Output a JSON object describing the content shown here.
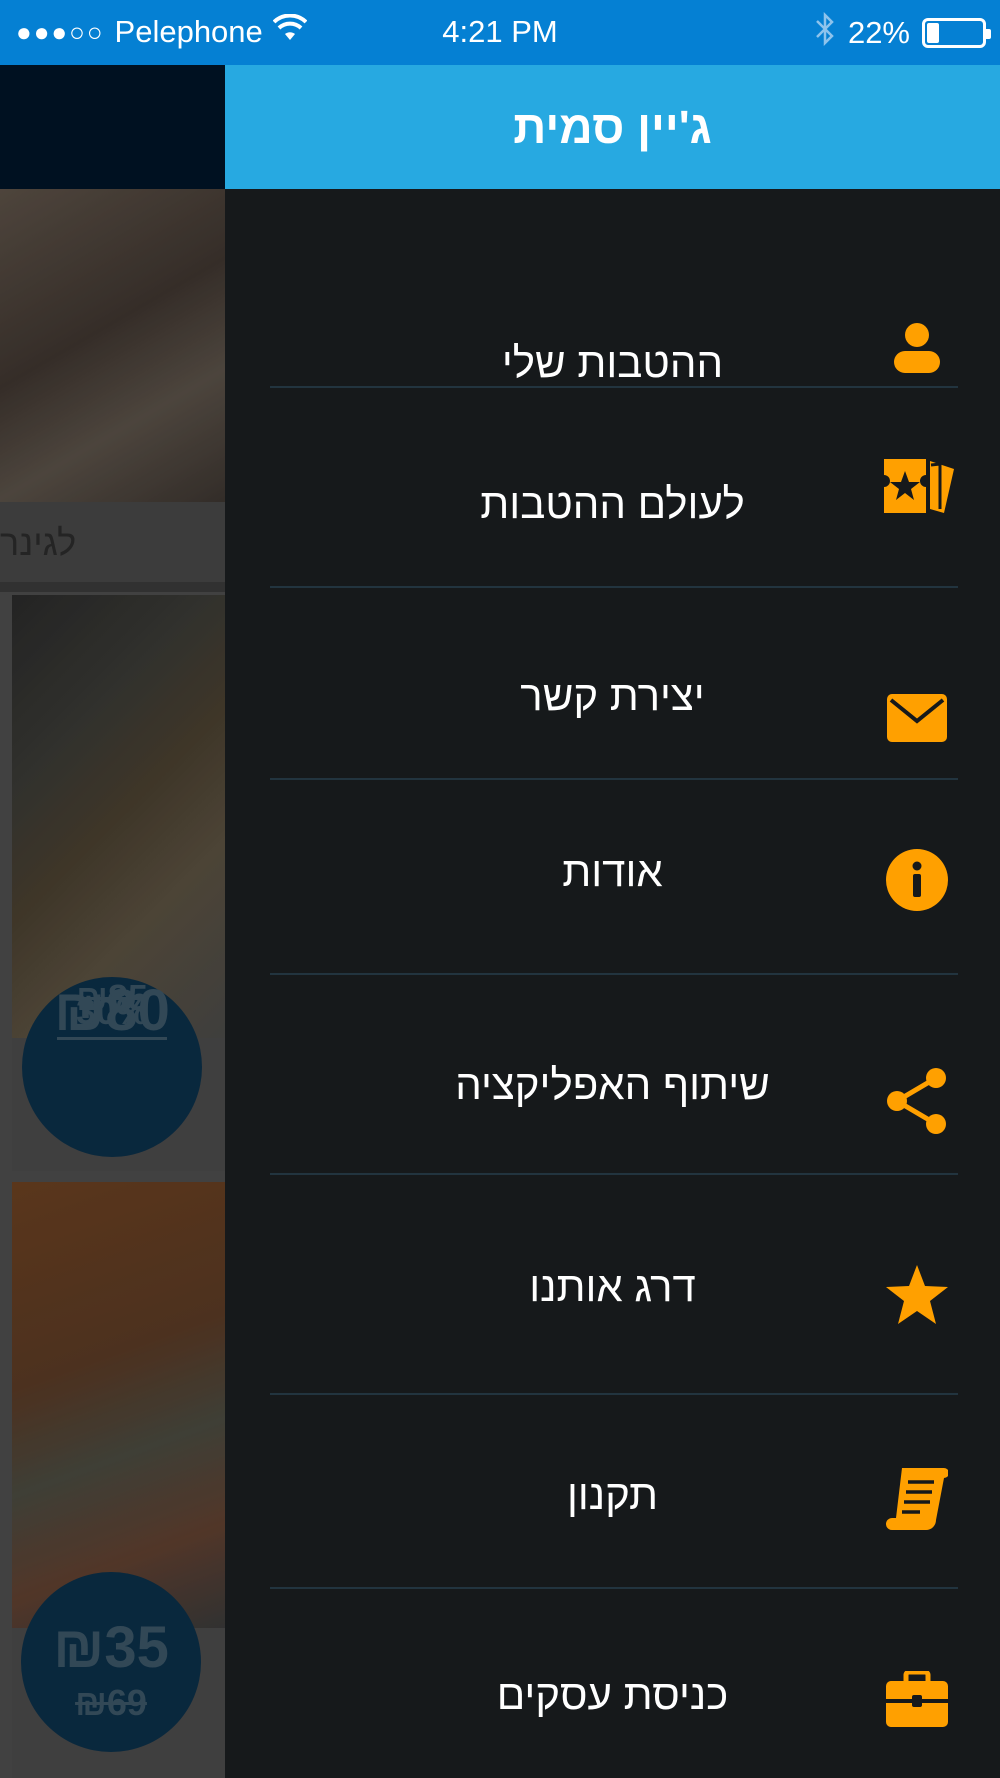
{
  "status_bar": {
    "signal": "●●●○○",
    "carrier": "Pelephone",
    "time": "4:21 PM",
    "battery_text": "22%",
    "battery_level": 0.22
  },
  "background": {
    "caption": "לגינר",
    "card1": {
      "discount": "30%",
      "price": "₪80",
      "old_price": "₪85"
    },
    "card2": {
      "price": "₪35",
      "old_price": "₪69"
    }
  },
  "drawer": {
    "title": "ג'יין סמית",
    "items": [
      {
        "label": "ההטבות שלי",
        "icon": "user-icon"
      },
      {
        "label": "לעולם ההטבות",
        "icon": "ticket-star-icon"
      },
      {
        "label": "יצירת קשר",
        "icon": "envelope-icon"
      },
      {
        "label": "אודות",
        "icon": "info-icon"
      },
      {
        "label": "שיתוף האפליקציה",
        "icon": "share-icon"
      },
      {
        "label": "דרג אותנו",
        "icon": "star-icon"
      },
      {
        "label": "תקנון",
        "icon": "scroll-icon"
      },
      {
        "label": "כניסת עסקים",
        "icon": "briefcase-icon"
      }
    ]
  },
  "colors": {
    "accent_icon": "#ffa000",
    "drawer_header": "#27a9e1",
    "status_bar": "#0580d3",
    "drawer_bg": "#16191b"
  }
}
